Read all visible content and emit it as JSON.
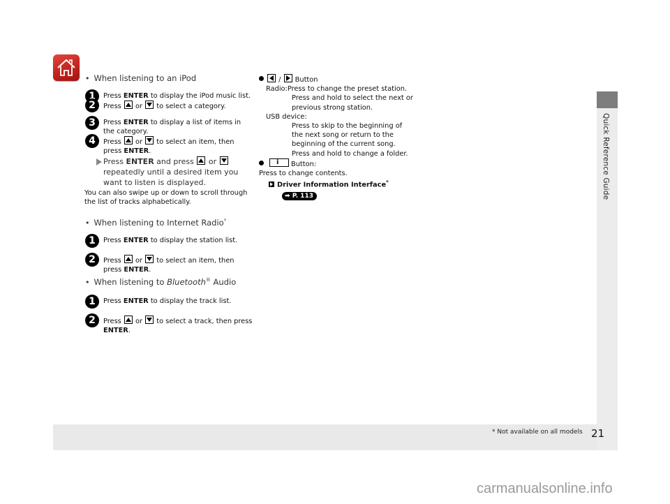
{
  "side_tab": {
    "label": "Quick Reference Guide"
  },
  "home_icon": "home-icon",
  "left": {
    "ipod": {
      "heading": "When listening to an iPod",
      "step1": {
        "num": "1",
        "pre": "Press ",
        "key": "ENTER",
        "post": " to display the iPod music list."
      },
      "step2": {
        "num": "2",
        "pre": "Press ",
        "or": " or ",
        "post": " to select a category."
      },
      "step3": {
        "num": "3",
        "pre": "Press ",
        "key": "ENTER",
        "post": " to display a list of items in the category."
      },
      "step4": {
        "num": "4",
        "pre": "Press ",
        "or": " or ",
        "mid": " to select an item, then press ",
        "key": "ENTER",
        "end": "."
      },
      "note": {
        "pre": "Press ",
        "key": "ENTER",
        "mid": " and press ",
        "or": " or ",
        "post": " repeatedly until a desired item you want to listen is displayed."
      },
      "swipe": "You can also swipe up or down to scroll through the list of tracks alphabetically."
    },
    "radio": {
      "heading": "When listening to Internet Radio",
      "asterisk": "*",
      "step1": {
        "num": "1",
        "pre": "Press ",
        "key": "ENTER",
        "post": " to display the station list."
      },
      "step2": {
        "num": "2",
        "pre": "Press ",
        "or": " or ",
        "mid": " to select an item, then press ",
        "key": "ENTER",
        "end": "."
      }
    },
    "bluetooth": {
      "heading_pre": "When listening to ",
      "heading_italic": "Bluetooth",
      "heading_reg": "®",
      "heading_post": "  Audio",
      "step1": {
        "num": "1",
        "pre": "Press ",
        "key": "ENTER",
        "post": " to display the track list."
      },
      "step2": {
        "num": "2",
        "pre": "Press ",
        "or": " or ",
        "mid": " to select a track, then press ",
        "key": "ENTER",
        "end": "."
      }
    }
  },
  "right": {
    "skip_button": {
      "sep": " / ",
      "label": " Button"
    },
    "radio_label": "Radio:",
    "radio_lines": [
      "Press to change the preset station.",
      "Press and hold to select the next or",
      "previous strong station."
    ],
    "usb_label": "USB device:",
    "usb_lines": [
      "Press to skip to the beginning of",
      "the next song or return to the",
      "beginning of the current song.",
      "Press and hold to change a folder."
    ],
    "info_button": {
      "glyph": "i",
      "label": "Button:"
    },
    "info_desc": "Press to change contents.",
    "xref": {
      "text": "Driver Information Interface",
      "asterisk": "*",
      "page_ref": "P. 113"
    }
  },
  "footer": {
    "footnote": "* Not available on all models",
    "page_number": "21"
  },
  "watermark": "carmanualsonline.info"
}
